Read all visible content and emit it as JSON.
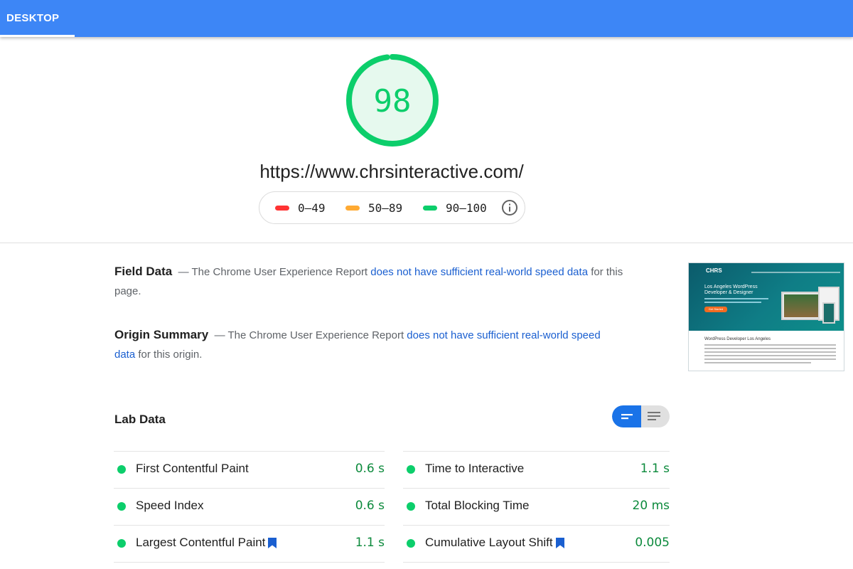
{
  "header": {
    "tab_label": "DESKTOP"
  },
  "score": {
    "value": "98",
    "fraction": 0.98,
    "color": "#0cce6b"
  },
  "url": "https://www.chrsinteractive.com/",
  "legend": {
    "items": [
      {
        "label": "0–49",
        "color": "#ff3333"
      },
      {
        "label": "50–89",
        "color": "#ffaa33"
      },
      {
        "label": "90–100",
        "color": "#0cce6b"
      }
    ]
  },
  "field_data": {
    "title": "Field Data",
    "dash": "—",
    "text_before": "The Chrome User Experience Report",
    "link": "does not have sufficient real-world speed data",
    "text_after": "for this page."
  },
  "origin_summary": {
    "title": "Origin Summary",
    "dash": "—",
    "text_before": "The Chrome User Experience Report",
    "link": "does not have sufficient real-world speed data",
    "text_after": "for this origin."
  },
  "thumbnail": {
    "logo": "CHRS",
    "hero_title": "Los Angeles WordPress Developer & Designer",
    "cta": "Get Started",
    "section_title": "WordPress Developer Los Angeles"
  },
  "lab_data": {
    "title": "Lab Data",
    "metrics_left": [
      {
        "name": "First Contentful Paint",
        "value": "0.6 s",
        "bookmark": false
      },
      {
        "name": "Speed Index",
        "value": "0.6 s",
        "bookmark": false
      },
      {
        "name": "Largest Contentful Paint",
        "value": "1.1 s",
        "bookmark": true
      }
    ],
    "metrics_right": [
      {
        "name": "Time to Interactive",
        "value": "1.1 s",
        "bookmark": false
      },
      {
        "name": "Total Blocking Time",
        "value": "20 ms",
        "bookmark": false
      },
      {
        "name": "Cumulative Layout Shift",
        "value": "0.005",
        "bookmark": true
      }
    ]
  },
  "colors": {
    "brand_blue": "#3d86f6",
    "link_blue": "#1a5fd0",
    "pass_green": "#0cce6b",
    "value_green": "#0c8a3c"
  }
}
